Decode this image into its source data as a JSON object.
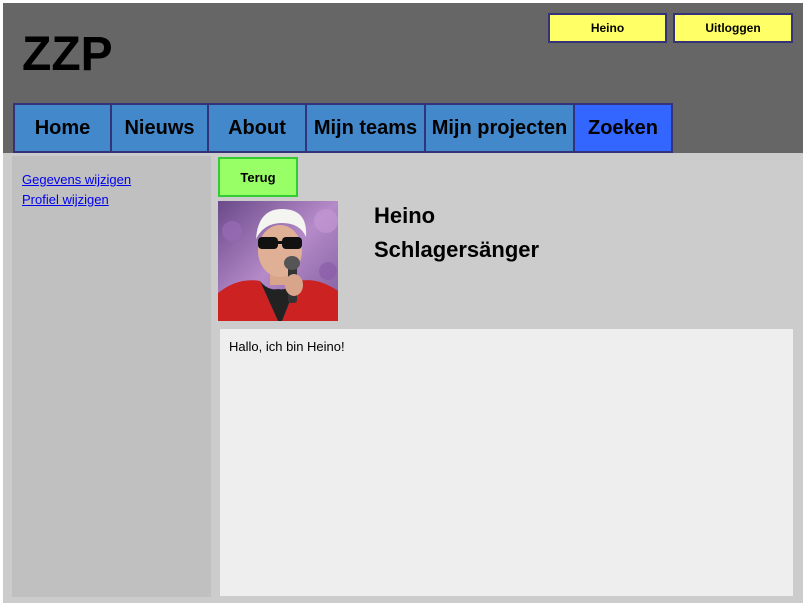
{
  "app": {
    "logo": "ZZP"
  },
  "header": {
    "user_label": "Heino",
    "logout_label": "Uitloggen"
  },
  "nav": {
    "home": "Home",
    "news": "Nieuws",
    "about": "About",
    "teams": "Mijn teams",
    "projects": "Mijn projecten",
    "search": "Zoeken"
  },
  "sidebar": {
    "edit_details": "Gegevens wijzigen",
    "edit_profile": "Profiel wijzigen"
  },
  "profile": {
    "back_label": "Terug",
    "name": "Heino",
    "role": "Schlagersänger",
    "about": "Hallo, ich bin Heino!"
  },
  "colors": {
    "header_bg": "#666666",
    "page_bg": "#cccccc",
    "nav_bg": "#4488cc",
    "nav_active_bg": "#3366ff",
    "top_button_bg": "#ffff66",
    "back_button_bg": "#99ff66",
    "link": "#0000ee"
  }
}
